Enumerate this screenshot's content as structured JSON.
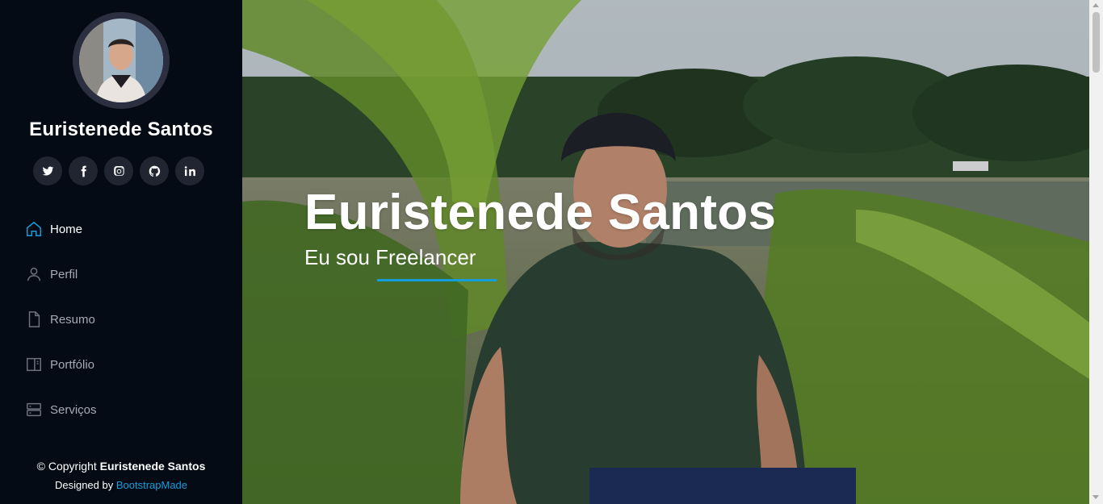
{
  "profile": {
    "name": "Euristenede Santos"
  },
  "social": [
    {
      "name": "twitter",
      "label": "twitter-icon"
    },
    {
      "name": "facebook",
      "label": "facebook-icon"
    },
    {
      "name": "instagram",
      "label": "instagram-icon"
    },
    {
      "name": "github",
      "label": "github-icon"
    },
    {
      "name": "linkedin",
      "label": "linkedin-icon"
    }
  ],
  "nav": {
    "items": [
      {
        "label": "Home",
        "icon": "home-icon",
        "active": true
      },
      {
        "label": "Perfil",
        "icon": "person-icon",
        "active": false
      },
      {
        "label": "Resumo",
        "icon": "file-icon",
        "active": false
      },
      {
        "label": "Portfólio",
        "icon": "layout-icon",
        "active": false
      },
      {
        "label": "Serviços",
        "icon": "server-icon",
        "active": false
      }
    ]
  },
  "footer": {
    "copyright_prefix": "© Copyright",
    "copyright_name": "Euristenede Santos",
    "designed_by": "Designed by",
    "designed_link": "BootstrapMade"
  },
  "hero": {
    "title": "Euristenede Santos",
    "subtitle": "Eu sou Freelancer"
  },
  "colors": {
    "accent": "#149ddd",
    "sidebar_bg": "#040b14",
    "nav_text": "#a8a9b4"
  }
}
